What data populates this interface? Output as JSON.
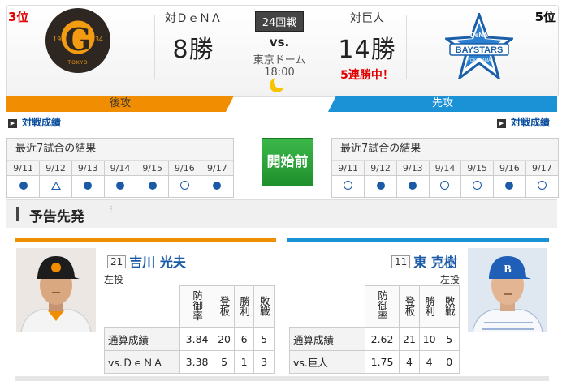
{
  "header": {
    "left_rank": "3位",
    "right_rank": "5位",
    "left_vs_label": "対ＤｅＮＡ",
    "left_wins": "8勝",
    "right_vs_label": "対巨人",
    "right_wins": "14勝",
    "right_streak": "5連勝中！",
    "game_number": "24回戦",
    "vs_text": "vs.",
    "stadium": "東京ドーム",
    "start_time": "18:00",
    "left_logo": {
      "letter": "G",
      "year_left": "19",
      "year_right": "34",
      "city": "TOKYO"
    },
    "right_logo": {
      "text": "BAYSTARS",
      "small": "YOKOHAMA",
      "top": "DeNA"
    }
  },
  "bars": {
    "left": "後攻",
    "right": "先攻"
  },
  "links": {
    "left": "対戦成績",
    "right": "対戦成績"
  },
  "results_left": {
    "title": "最近7試合の結果",
    "dates": [
      "9/11",
      "9/12",
      "9/13",
      "9/14",
      "9/15",
      "9/16",
      "9/17"
    ],
    "marks": [
      "win",
      "draw",
      "win",
      "win",
      "win",
      "loss",
      "win"
    ]
  },
  "results_right": {
    "title": "最近7試合の結果",
    "dates": [
      "9/11",
      "9/12",
      "9/13",
      "9/14",
      "9/15",
      "9/16",
      "9/17"
    ],
    "marks": [
      "loss",
      "win",
      "win",
      "loss",
      "loss",
      "win",
      "loss"
    ]
  },
  "status": "開始前",
  "section_title": "予告先発",
  "pitcher_left": {
    "number": "21",
    "name": "吉川 光夫",
    "hand": "左投",
    "headers": [
      "防御率",
      "登板",
      "勝利",
      "敗戦"
    ],
    "rows": [
      {
        "label": "通算成績",
        "values": [
          "3.84",
          "20",
          "6",
          "5"
        ]
      },
      {
        "label": "vs.ＤｅＮＡ",
        "values": [
          "3.38",
          "5",
          "1",
          "3"
        ]
      }
    ]
  },
  "pitcher_right": {
    "number": "11",
    "name": "東 克樹",
    "hand": "左投",
    "headers": [
      "防御率",
      "登板",
      "勝利",
      "敗戦"
    ],
    "rows": [
      {
        "label": "通算成績",
        "values": [
          "2.62",
          "21",
          "10",
          "5"
        ]
      },
      {
        "label": "vs.巨人",
        "values": [
          "1.75",
          "4",
          "4",
          "0"
        ]
      }
    ]
  },
  "colors": {
    "giants": "#f18d00",
    "baystars": "#1b91d6",
    "status_green": "#2aa33a",
    "link_blue": "#0b4f9e",
    "accent_red": "#e00000"
  }
}
